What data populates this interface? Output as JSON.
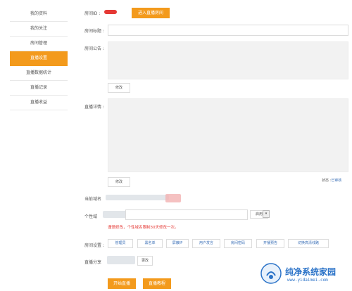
{
  "sidebar": {
    "items": [
      {
        "label": "我的资料",
        "active": false
      },
      {
        "label": "我的关注",
        "active": false
      },
      {
        "label": "房间管理",
        "active": false
      },
      {
        "label": "直播设置",
        "active": true
      },
      {
        "label": "直播数据统计",
        "active": false
      },
      {
        "label": "直播记录",
        "active": false
      },
      {
        "label": "直播收益",
        "active": false
      }
    ]
  },
  "room_id": {
    "label": "房间ID :",
    "enter_button": "进入直播房间"
  },
  "room_title": {
    "label": "房间标题 :",
    "value": ""
  },
  "room_notice": {
    "label": "房间公告 :",
    "edit_button": "修改"
  },
  "live_details": {
    "label": "直播详情 :",
    "edit_button": "修改"
  },
  "status": {
    "label": "状态 :",
    "value": "已审核"
  },
  "domain": {
    "label": "当前域名"
  },
  "personal_domain": {
    "label": "个性域",
    "select_value": "启用",
    "note": "谨慎修改，个性域名限制30天修改一次。"
  },
  "room_settings": {
    "label": "房间设置 :",
    "buttons": [
      "管理员",
      "黑名单",
      "屏蔽IP",
      "用户发言",
      "房间密码",
      "开播预告",
      "切换高清线路"
    ]
  },
  "live_share": {
    "label": "直播分享",
    "edit_button": "更改"
  },
  "actions": {
    "start": "开始直播",
    "tutorial": "直播教程"
  },
  "watermark": {
    "title": "纯净系统家园",
    "url": "www.yidaimei.com"
  },
  "colors": {
    "accent": "#f39a1c",
    "link": "#3a6fb7",
    "warning": "#e53935"
  }
}
